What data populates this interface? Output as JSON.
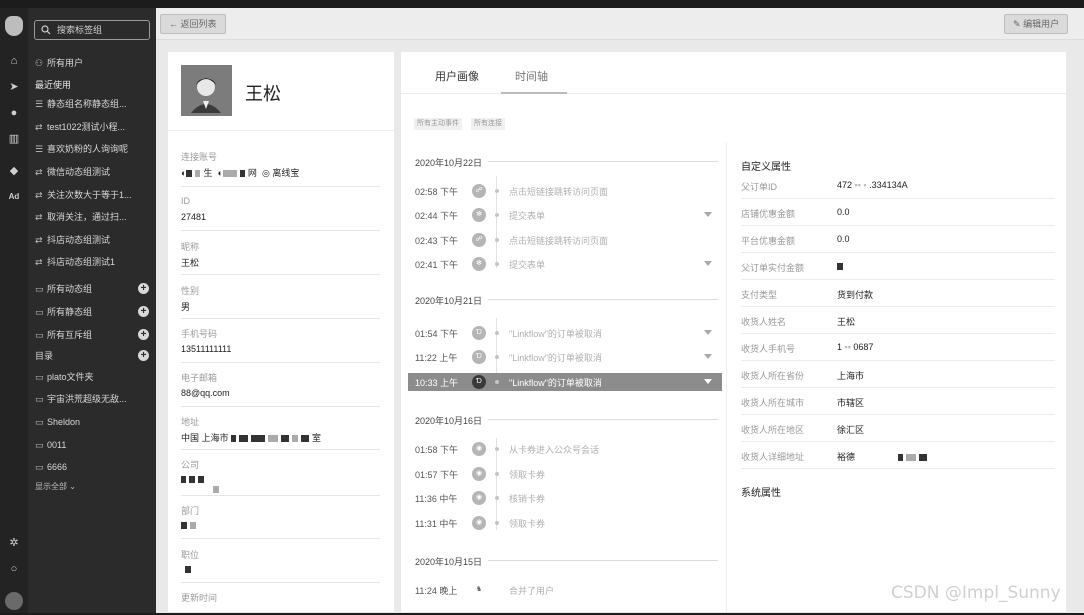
{
  "sidebar": {
    "search_placeholder": "搜索标签组",
    "all_users": "所有用户",
    "recent_title": "最近使用",
    "recent": [
      {
        "label": "静态组名称静态组..."
      },
      {
        "label": "test1022测试小程..."
      },
      {
        "label": "喜欢奶粉的人询询呢"
      },
      {
        "label": "微信动态组测试"
      },
      {
        "label": "关注次数大于等于1..."
      },
      {
        "label": "取消关注，通过扫..."
      },
      {
        "label": "抖店动态组测试"
      },
      {
        "label": "抖店动态组测试1"
      }
    ],
    "groups": [
      {
        "label": "所有动态组"
      },
      {
        "label": "所有静态组"
      },
      {
        "label": "所有互斥组"
      }
    ],
    "dir_title": "目录",
    "dirs": [
      {
        "label": "plato文件夹"
      },
      {
        "label": "宇宙洪荒超级无敌..."
      },
      {
        "label": "Sheldon"
      },
      {
        "label": "0011"
      },
      {
        "label": "6666"
      }
    ],
    "show_all": "显示全部"
  },
  "toolbar": {
    "back_label": "返回列表",
    "edit_label": "编辑用户"
  },
  "profile": {
    "name": "王松",
    "fields": {
      "accounts_label": "连接账号",
      "accounts_parts": [
        "生",
        "网",
        "离线宝"
      ],
      "id_label": "ID",
      "id_value": "27481",
      "nickname_label": "昵称",
      "nickname_value": "王松",
      "gender_label": "性别",
      "gender_value": "男",
      "phone_label": "手机号码",
      "phone_value": "13511111111",
      "email_label": "电子邮箱",
      "email_value": "88@qq.com",
      "address_label": "地址",
      "address_value": "中国 上海市",
      "address_tail": "室",
      "company_label": "公司",
      "dept_label": "部门",
      "position_label": "职位",
      "updated_label": "更新时间"
    }
  },
  "tabs": [
    {
      "label": "用户画像"
    },
    {
      "label": "时间轴"
    }
  ],
  "filters": {
    "chip1": "所有主动事件",
    "chip2": "所有连接"
  },
  "timeline": {
    "days": [
      {
        "date": "2020年10月22日",
        "events": [
          {
            "time": "02:58 下午",
            "text": "点击短链接跳转访问页面"
          },
          {
            "time": "02:44 下午",
            "text": "提交表单"
          },
          {
            "time": "02:43 下午",
            "text": "点击短链接跳转访问页面"
          },
          {
            "time": "02:41 下午",
            "text": "提交表单"
          }
        ]
      },
      {
        "date": "2020年10月21日",
        "events": [
          {
            "time": "01:54 下午",
            "text": "\"Linkflow\"的订单被取消"
          },
          {
            "time": "11:22 上午",
            "text": "\"Linkflow\"的订单被取消"
          },
          {
            "time": "10:33 上午",
            "text": "\"Linkflow\"的订单被取消"
          }
        ]
      },
      {
        "date": "2020年10月16日",
        "events": [
          {
            "time": "01:58 下午",
            "text": "从卡券进入公众号会话"
          },
          {
            "time": "01:57 下午",
            "text": "领取卡券"
          },
          {
            "time": "11:36 中午",
            "text": "核销卡券"
          },
          {
            "time": "11:31 中午",
            "text": "领取卡券"
          }
        ]
      },
      {
        "date": "2020年10月15日",
        "events": [
          {
            "time": "11:24 晚上",
            "text": "合并了用户"
          }
        ]
      }
    ]
  },
  "custom_props": {
    "title": "自定义属性",
    "rows": [
      {
        "k": "父订单ID",
        "v_start": "472",
        "v_end": ".334134A"
      },
      {
        "k": "店铺优惠金额",
        "v": "0.0"
      },
      {
        "k": "平台优惠金额",
        "v": "0.0"
      },
      {
        "k": "父订单实付金额",
        "v": ""
      },
      {
        "k": "支付类型",
        "v": "货到付款"
      },
      {
        "k": "收货人姓名",
        "v": "王松"
      },
      {
        "k": "收货人手机号",
        "v_start": "1",
        "v_end": "0687"
      },
      {
        "k": "收货人所在省份",
        "v": "上海市"
      },
      {
        "k": "收货人所在城市",
        "v": "市辖区"
      },
      {
        "k": "收货人所在地区",
        "v": "徐汇区"
      },
      {
        "k": "收货人详细地址",
        "v_start": "裕德",
        "v_end": ""
      }
    ]
  },
  "system_props": {
    "title": "系统属性"
  },
  "watermark": "CSDN @Impl_Sunny"
}
